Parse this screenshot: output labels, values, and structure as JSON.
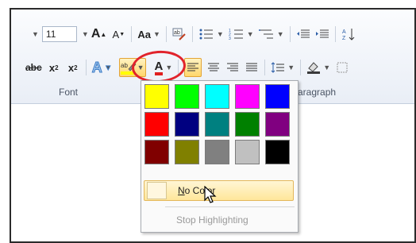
{
  "ribbon": {
    "font_size": "11",
    "groups": {
      "font": "Font",
      "paragraph": "Paragraph"
    }
  },
  "highlight_menu": {
    "swatches": [
      "#ffff00",
      "#00ff00",
      "#00ffff",
      "#ff00ff",
      "#0000ff",
      "#ff0000",
      "#000080",
      "#008080",
      "#008000",
      "#800080",
      "#800000",
      "#808000",
      "#808080",
      "#c0c0c0",
      "#000000"
    ],
    "no_color": "No Color",
    "stop_highlighting": "Stop Highlighting"
  },
  "colors": {
    "annotation_circle": "#e1232b",
    "hover_fill": "#ffe69a"
  },
  "icons": [
    "dropdown-arrow-icon",
    "grow-font-icon",
    "shrink-font-icon",
    "change-case-icon",
    "clear-formatting-icon",
    "bullets-icon",
    "numbering-icon",
    "multilevel-list-icon",
    "decrease-indent-icon",
    "increase-indent-icon",
    "sort-icon",
    "strikethrough-icon",
    "subscript-icon",
    "superscript-icon",
    "text-effects-icon",
    "text-highlight-color-icon",
    "font-color-icon",
    "align-left-icon",
    "center-icon",
    "align-right-icon",
    "justify-icon",
    "line-spacing-icon",
    "shading-icon",
    "borders-icon",
    "mouse-pointer-icon"
  ]
}
